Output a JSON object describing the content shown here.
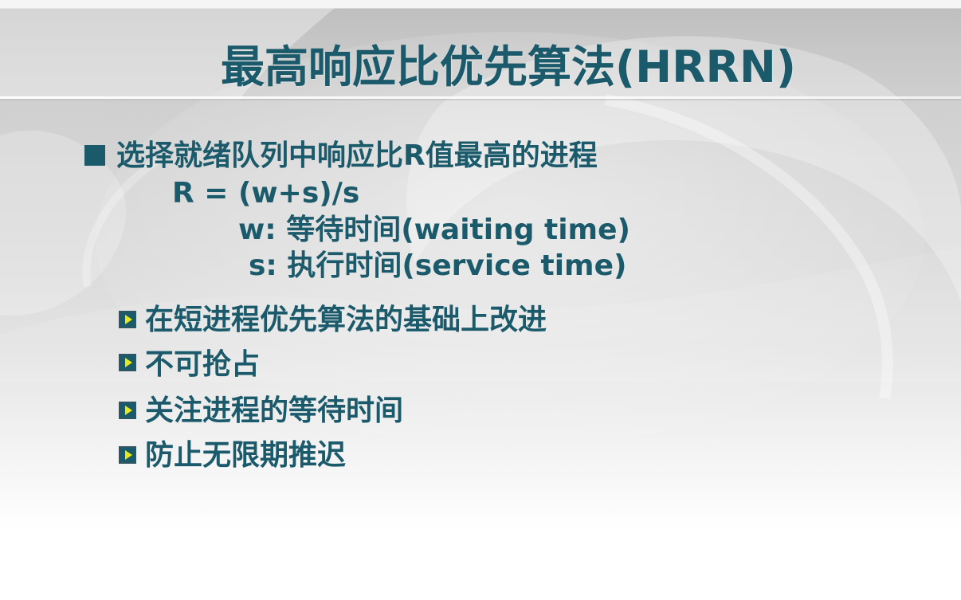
{
  "slide": {
    "title": "最高响应比优先算法(HRRN)",
    "main_bullet": "选择就绪队列中响应比R值最高的进程",
    "formula": {
      "line1": "R =   (w+s)/s",
      "line2": "w: 等待时间(waiting time)",
      "line3": "s: 执行时间(service time)"
    },
    "sub_bullets": [
      "在短进程优先算法的基础上改进",
      "不可抢占",
      "关注进程的等待时间",
      "防止无限期推迟"
    ]
  },
  "colors": {
    "text": "#1b5a6b",
    "sub_bullet_arrow": "#e6e81a"
  }
}
